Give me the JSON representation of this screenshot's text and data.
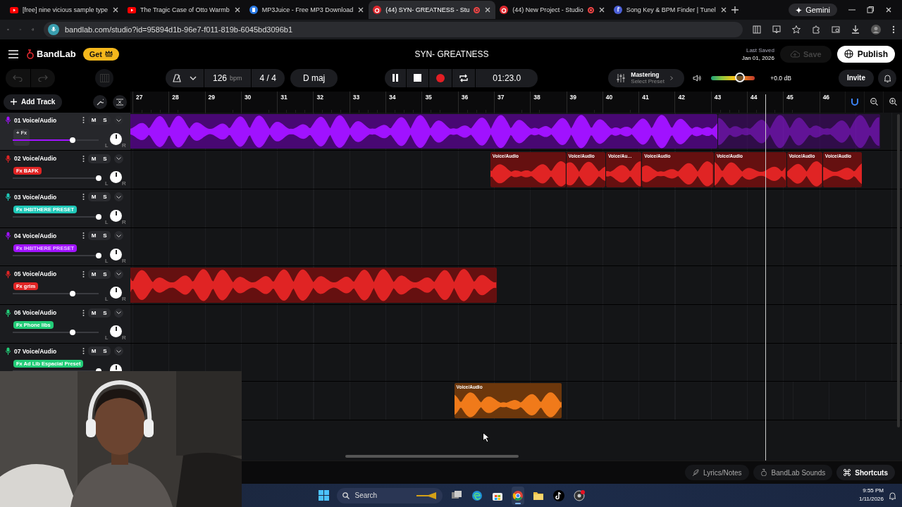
{
  "browser": {
    "tabs": [
      {
        "title": "[free] nine vicious sample type",
        "kind": "youtube",
        "selected": false,
        "recording": false
      },
      {
        "title": "The Tragic Case of Otto Warmb",
        "kind": "youtube",
        "selected": false,
        "recording": false
      },
      {
        "title": "MP3Juice - Free MP3 Download",
        "kind": "mp3",
        "selected": false,
        "recording": false
      },
      {
        "title": "(44) SYN- GREATNESS - Stu",
        "kind": "bandlab",
        "selected": true,
        "recording": true
      },
      {
        "title": "(44) New Project - Studio",
        "kind": "bandlab",
        "selected": false,
        "recording": true
      },
      {
        "title": "Song Key & BPM Finder | Tunel",
        "kind": "key",
        "selected": false,
        "recording": false
      }
    ],
    "gemini": "Gemini",
    "address": "bandlab.com/studio?id=95894d1b-96e7-f011-819b-6045bd3096b1"
  },
  "header": {
    "brand": "BandLab",
    "get": "Get",
    "title": "SYN- GREATNESS",
    "last_saved_label": "Last Saved",
    "last_saved_date": "Jan 01, 2026",
    "save": {
      "label": "Save",
      "disabled": true
    },
    "publish": "Publish"
  },
  "toolbar": {
    "tempo": "126",
    "tempo_unit": "bpm",
    "time_signature": "4 / 4",
    "key": "D maj",
    "playing": true,
    "time": "01:23.0",
    "mastering": "Mastering",
    "mastering_preset": "Select Preset",
    "master_volume": {
      "level": 0.65
    },
    "master_gain": "+0.0 dB",
    "invite": "Invite"
  },
  "add_track": "Add Track",
  "ruler": [
    "27",
    "28",
    "29",
    "30",
    "31",
    "32",
    "33",
    "34",
    "35",
    "36",
    "37",
    "38",
    "39",
    "40",
    "41",
    "42",
    "43",
    "44",
    "45",
    "46"
  ],
  "tracks": [
    {
      "number": "01",
      "name": "Voice/Audio",
      "color": "#a012ff",
      "selected": true,
      "fx": {
        "kind": "add",
        "label": "+ Fx"
      },
      "mute": "M",
      "solo": "S",
      "level": 0.7,
      "pan": [
        "L",
        "R"
      ],
      "clips": [
        {
          "faded": false
        },
        {
          "faded": true
        }
      ]
    },
    {
      "number": "02",
      "name": "Voice/Audio",
      "color": "#e02424",
      "selected": false,
      "fx": {
        "kind": "preset",
        "label": "Fx BAFK"
      },
      "mute": "M",
      "solo": "S",
      "level": 1,
      "pan": [
        "L",
        "R"
      ],
      "clips": [
        {
          "faded": false,
          "label": "Voice/Audio"
        },
        {
          "faded": false,
          "label": "Voice/Audio"
        },
        {
          "faded": false,
          "label": "Voice/Au…"
        },
        {
          "faded": false,
          "label": "Voice/Audio"
        },
        {
          "faded": false,
          "label": "Voice/Audio"
        },
        {
          "faded": false,
          "label": "Voice/Audio"
        },
        {
          "faded": false,
          "label": "Voice/Audio"
        }
      ]
    },
    {
      "number": "03",
      "name": "Voice/Audio",
      "color": "#1fc8b8",
      "selected": false,
      "fx": {
        "kind": "preset",
        "label": "Fx IH8ITHERE PRESET"
      },
      "mute": "M",
      "solo": "S",
      "level": 1,
      "pan": [
        "L",
        "R"
      ]
    },
    {
      "number": "04",
      "name": "Voice/Audio",
      "color": "#a012ff",
      "selected": false,
      "fx": {
        "kind": "preset",
        "label": "Fx IH8ITHERE PRESET"
      },
      "mute": "M",
      "solo": "S",
      "level": 1,
      "pan": [
        "L",
        "R"
      ]
    },
    {
      "number": "05",
      "name": "Voice/Audio",
      "color": "#e02424",
      "selected": false,
      "fx": {
        "kind": "preset",
        "label": "Fx grim"
      },
      "mute": "M",
      "solo": "S",
      "level": 0.7,
      "pan": [
        "L",
        "R"
      ],
      "clips": [
        {
          "faded": false
        }
      ]
    },
    {
      "number": "06",
      "name": "Voice/Audio",
      "color": "#22cc77",
      "selected": false,
      "fx": {
        "kind": "preset",
        "label": "Fx Phone libs"
      },
      "mute": "M",
      "solo": "S",
      "level": 0.7,
      "pan": [
        "L",
        "R"
      ]
    },
    {
      "number": "07",
      "name": "Voice/Audio",
      "color": "#22cc77",
      "selected": false,
      "fx": {
        "kind": "preset",
        "label": "Fx Ad Lib Espacial Preset"
      },
      "mute": "M",
      "solo": "S",
      "level": 1
    },
    {
      "color": "#f07a1a",
      "clips": [
        {
          "faded": false,
          "label": "Voice/Audio"
        }
      ]
    }
  ],
  "footer": [
    {
      "kind": "lyrics",
      "label": "Lyrics/Notes"
    },
    {
      "kind": "sounds",
      "label": "BandLab Sounds"
    },
    {
      "kind": "shortcuts",
      "label": "Shortcuts"
    }
  ],
  "taskbar": {
    "search": "Search",
    "apps": [
      {
        "kind": "taskview",
        "selected": false
      },
      {
        "kind": "edge",
        "selected": false
      },
      {
        "kind": "store",
        "selected": false
      },
      {
        "kind": "chrome",
        "selected": true
      },
      {
        "kind": "explorer",
        "selected": false
      },
      {
        "kind": "tiktok",
        "selected": false
      },
      {
        "kind": "recorder",
        "selected": false
      }
    ],
    "time": "9:55 PM",
    "date": "1/11/2026"
  }
}
